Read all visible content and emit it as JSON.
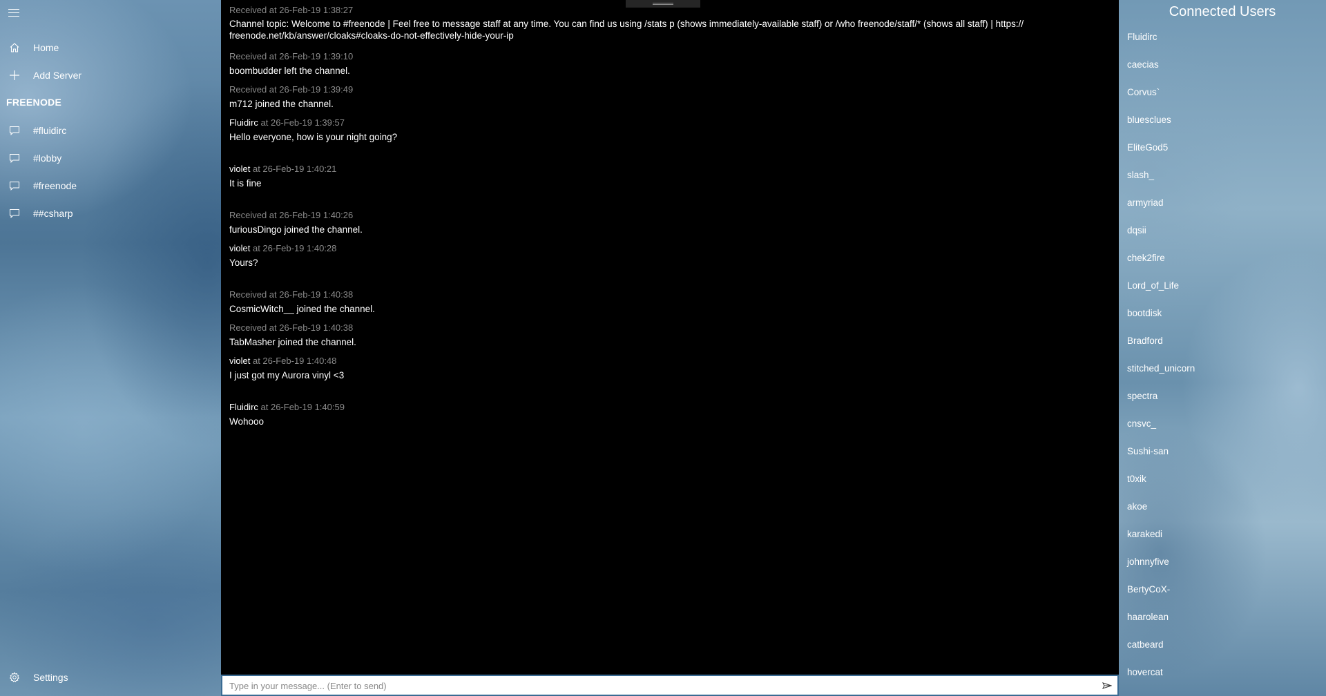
{
  "sidebar": {
    "home_label": "Home",
    "add_server_label": "Add Server",
    "server_name": "FREENODE",
    "channels": [
      "#fluidirc",
      "#lobby",
      "#freenode",
      "##csharp"
    ],
    "settings_label": "Settings"
  },
  "chat": {
    "messages": [
      {
        "kind": "system",
        "meta": "Received at  26-Feb-19 1:38:27",
        "text": "Channel topic: Welcome to #freenode | Feel free to message staff at any time. You can find us using /stats p (shows immediately-available staff) or /who freenode/staff/* (shows all staff) | https://",
        "text2": "freenode.net/kb/answer/cloaks#cloaks-do-not-effectively-hide-your-ip"
      },
      {
        "kind": "system",
        "meta": "Received at  26-Feb-19 1:39:10",
        "text": "boombudder left the channel."
      },
      {
        "kind": "system",
        "meta": "Received at  26-Feb-19 1:39:49",
        "text": "m712 joined the channel."
      },
      {
        "kind": "user",
        "nick": "Fluidirc",
        "at": " at 26-Feb-19 1:39:57",
        "text": "Hello everyone, how is your night going?"
      },
      {
        "kind": "user",
        "nick": "violet",
        "at": " at 26-Feb-19 1:40:21",
        "text": "It is fine"
      },
      {
        "kind": "system",
        "meta": "Received at  26-Feb-19 1:40:26",
        "text": "furiousDingo joined the channel."
      },
      {
        "kind": "user",
        "nick": "violet",
        "at": " at 26-Feb-19 1:40:28",
        "text": "Yours?"
      },
      {
        "kind": "system",
        "meta": "Received at  26-Feb-19 1:40:38",
        "text": "CosmicWitch__ joined the channel."
      },
      {
        "kind": "system",
        "meta": "Received at  26-Feb-19 1:40:38",
        "text": "TabMasher joined the channel."
      },
      {
        "kind": "user",
        "nick": "violet",
        "at": " at 26-Feb-19 1:40:48",
        "text": "I just got my Aurora vinyl <3"
      },
      {
        "kind": "user",
        "nick": "Fluidirc",
        "at": " at 26-Feb-19 1:40:59",
        "text": "Wohooo"
      }
    ]
  },
  "input": {
    "placeholder": "Type in your message... (Enter to send)"
  },
  "users": {
    "title": "Connected Users",
    "list": [
      "Fluidirc",
      "caecias",
      "Corvus`",
      "bluesclues",
      "EliteGod5",
      "slash_",
      "armyriad",
      "dqsii",
      "chek2fire",
      "Lord_of_Life",
      "bootdisk",
      "Bradford",
      "stitched_unicorn",
      "spectra",
      "cnsvc_",
      "Sushi-san",
      "t0xik",
      "akoe",
      "karakedi",
      "johnnyfive",
      "BertyCoX-",
      "haarolean",
      "catbeard",
      "hovercat"
    ]
  },
  "icons": {
    "menu": "hamburger-icon",
    "home": "home-icon",
    "add": "plus-icon",
    "channel": "chat-bubble-icon",
    "settings": "gear-icon",
    "send": "send-icon"
  }
}
